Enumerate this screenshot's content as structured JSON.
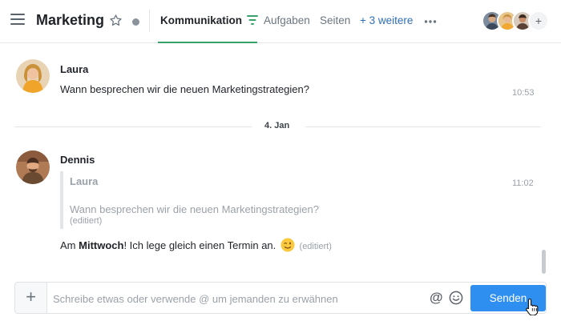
{
  "header": {
    "title": "Marketing",
    "tabs": [
      {
        "label": "Kommunikation",
        "active": true
      },
      {
        "label": "Aufgaben"
      },
      {
        "label": "Seiten"
      },
      {
        "label": "+ 3 weitere"
      }
    ],
    "members_more": "+"
  },
  "messages": [
    {
      "author": "Laura",
      "text": "Wann besprechen wir die neuen Marketingstrategien?",
      "time": "10:53"
    },
    {
      "author": "Dennis",
      "time": "11:02",
      "quote": {
        "author": "Laura",
        "text": "Wann besprechen wir die neuen Marketingstrategien?",
        "edited": "(editiert)"
      },
      "reply": {
        "before": "Am ",
        "bold": "Mittwoch",
        "after": "! Ich lege gleich einen Termin an.",
        "edited": "(editiert)"
      }
    }
  ],
  "date_divider": "4. Jan",
  "composer": {
    "placeholder": "Schreibe etwas oder verwende @ um jemanden zu erwähnen",
    "at_symbol": "@",
    "send_label": "Senden",
    "plus_label": "+"
  },
  "colors": {
    "accent": "#2f8ff0",
    "active_tab_underline": "#38a169",
    "link": "#2f6fb3"
  }
}
